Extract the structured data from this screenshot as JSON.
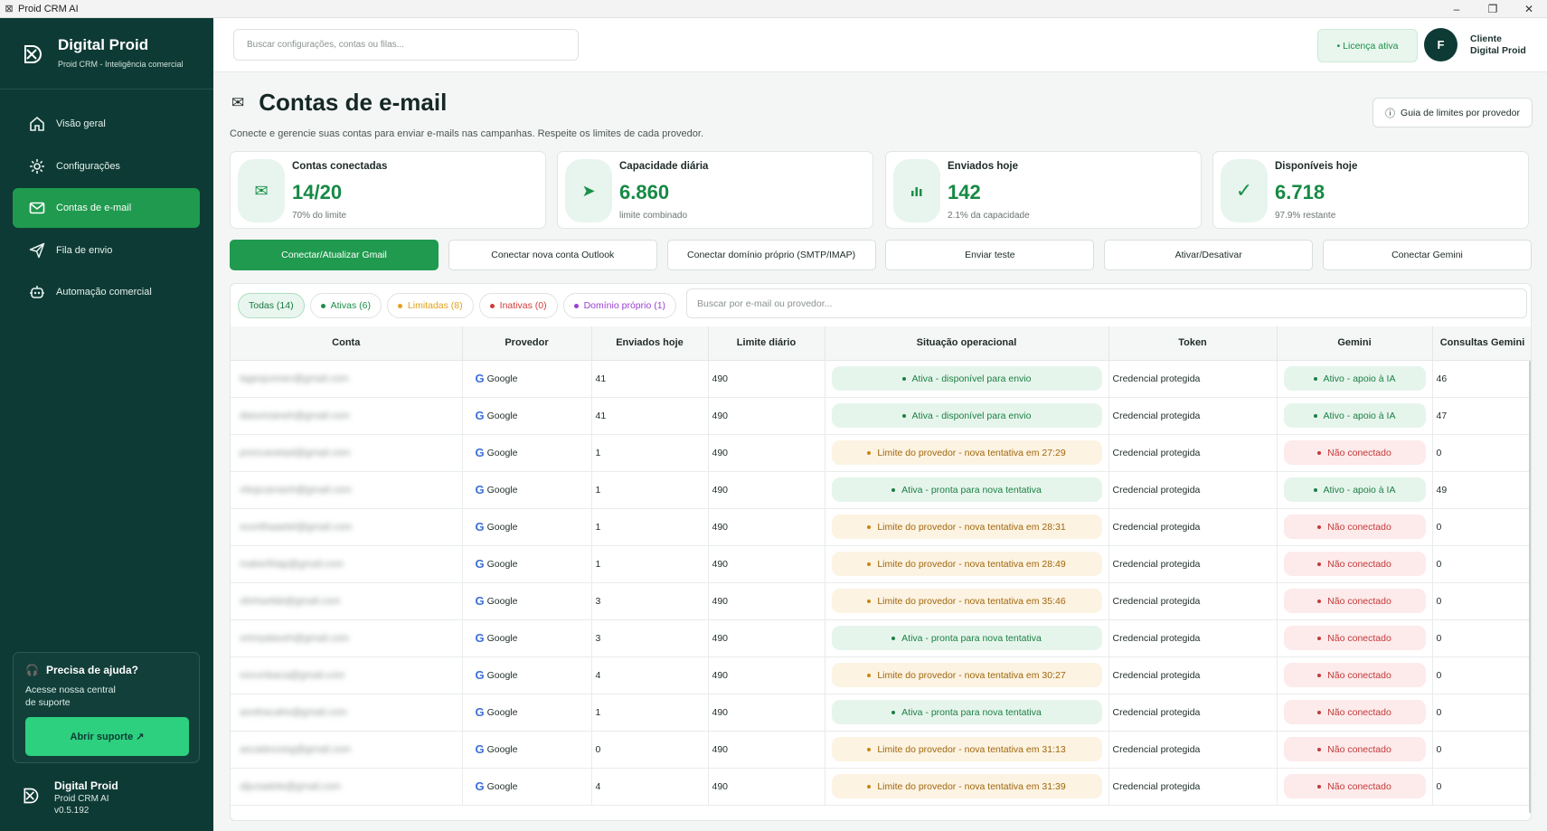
{
  "window": {
    "title": "Proid CRM AI",
    "controls": [
      "–",
      "❐",
      "✕"
    ]
  },
  "sidebar": {
    "brand_name": "Digital Proid",
    "brand_sub": "Proid CRM - Inteligência comercial",
    "items": [
      {
        "label": "Visão geral",
        "icon": "home-icon"
      },
      {
        "label": "Configurações",
        "icon": "gear-icon"
      },
      {
        "label": "Contas de e-mail",
        "icon": "mail-icon"
      },
      {
        "label": "Fila de envio",
        "icon": "send-icon"
      },
      {
        "label": "Automação comercial",
        "icon": "robot-icon"
      }
    ],
    "help": {
      "title": "Precisa de ajuda?",
      "desc": "Acesse nossa central de suporte",
      "button": "Abrir suporte ↗"
    },
    "footer": {
      "name": "Digital Proid",
      "app": "Proid CRM AI",
      "version": "v0.5.192"
    }
  },
  "topbar": {
    "search_placeholder": "Buscar configurações, contas ou filas...",
    "license": "• Licença ativa",
    "avatar": "F",
    "client_line1": "Cliente",
    "client_line2": "Digital Proid"
  },
  "page": {
    "title": "Contas de e-mail",
    "desc": "Conecte e gerencie suas contas para enviar e-mails nas campanhas. Respeite os limites de cada provedor.",
    "guide_button": "Guia de limites por provedor"
  },
  "stats": [
    {
      "label": "Contas conectadas",
      "value": "14/20",
      "sub": "70% do limite",
      "icon": "mail-icon",
      "glyph": "✉"
    },
    {
      "label": "Capacidade diária",
      "value": "6.860",
      "sub": "limite combinado",
      "icon": "send-icon",
      "glyph": "➤"
    },
    {
      "label": "Enviados hoje",
      "value": "142",
      "sub": "2.1% da capacidade",
      "icon": "bar-chart-icon",
      "glyph": "📊"
    },
    {
      "label": "Disponíveis hoje",
      "value": "6.718",
      "sub": "97.9% restante",
      "icon": "check-icon",
      "glyph": "✓"
    }
  ],
  "actions": [
    "Conectar/Atualizar Gmail",
    "Conectar nova conta Outlook",
    "Conectar domínio próprio (SMTP/IMAP)",
    "Enviar teste",
    "Ativar/Desativar",
    "Conectar Gemini"
  ],
  "filters": {
    "chips": [
      {
        "label": "Todas (14)",
        "color": ""
      },
      {
        "label": "Ativas (6)",
        "color": "#1b8f48"
      },
      {
        "label": "Limitadas (8)",
        "color": "#e2a21c"
      },
      {
        "label": "Inativas (0)",
        "color": "#d23b3b"
      },
      {
        "label": "Domínio próprio (1)",
        "color": "#9a3fd1"
      }
    ],
    "search_placeholder": "Buscar por e-mail ou provedor..."
  },
  "table": {
    "columns": [
      "Conta",
      "Provedor",
      "Enviados hoje",
      "Limite diário",
      "Situação operacional",
      "Token",
      "Gemini",
      "Consultas Gemini"
    ],
    "rows": [
      {
        "account": "lagesjunnior@gmail.com",
        "provider": "Google",
        "sent": "41",
        "limit": "490",
        "status": "Ativa - disponível para envio",
        "status_type": "ok",
        "token": "Credencial protegida",
        "gemini": "Ativo - apoio à IA",
        "gemini_type": "ok",
        "queries": "46"
      },
      {
        "account": "diasvivianeh@gmail.com",
        "provider": "Google",
        "sent": "41",
        "limit": "490",
        "status": "Ativa - disponível para envio",
        "status_type": "ok",
        "token": "Credencial protegida",
        "gemini": "Ativo - apoio à IA",
        "gemini_type": "ok",
        "queries": "47"
      },
      {
        "account": "proncanetad@gmail.com",
        "provider": "Google",
        "sent": "1",
        "limit": "490",
        "status": "Limite do provedor - nova tentativa em 27:29",
        "status_type": "warn",
        "token": "Credencial protegida",
        "gemini": "Não conectado",
        "gemini_type": "bad",
        "queries": "0"
      },
      {
        "account": "vitopcamanh@gmail.com",
        "provider": "Google",
        "sent": "1",
        "limit": "490",
        "status": "Ativa - pronta para nova tentativa",
        "status_type": "ok",
        "token": "Credencial protegida",
        "gemini": "Ativo - apoio à IA",
        "gemini_type": "ok",
        "queries": "49"
      },
      {
        "account": "ocorithaaetel@gmail.com",
        "provider": "Google",
        "sent": "1",
        "limit": "490",
        "status": "Limite do provedor - nova tentativa em 28:31",
        "status_type": "warn",
        "token": "Credencial protegida",
        "gemini": "Não conectado",
        "gemini_type": "bad",
        "queries": "0"
      },
      {
        "account": "makerlhlap@gmail.com",
        "provider": "Google",
        "sent": "1",
        "limit": "490",
        "status": "Limite do provedor - nova tentativa em 28:49",
        "status_type": "warn",
        "token": "Credencial protegida",
        "gemini": "Não conectado",
        "gemini_type": "bad",
        "queries": "0"
      },
      {
        "account": "olivhaofab@gmail.com",
        "provider": "Google",
        "sent": "3",
        "limit": "490",
        "status": "Limite do provedor - nova tentativa em 35:46",
        "status_type": "warn",
        "token": "Credencial protegida",
        "gemini": "Não conectado",
        "gemini_type": "bad",
        "queries": "0"
      },
      {
        "account": "ortmyalaveh@gmail.com",
        "provider": "Google",
        "sent": "3",
        "limit": "490",
        "status": "Ativa - pronta para nova tentativa",
        "status_type": "ok",
        "token": "Credencial protegida",
        "gemini": "Não conectado",
        "gemini_type": "bad",
        "queries": "0"
      },
      {
        "account": "oorumbaca@gmail.com",
        "provider": "Google",
        "sent": "4",
        "limit": "490",
        "status": "Limite do provedor - nova tentativa em 30:27",
        "status_type": "warn",
        "token": "Credencial protegida",
        "gemini": "Não conectado",
        "gemini_type": "bad",
        "queries": "0"
      },
      {
        "account": "aovthacafre@gmail.com",
        "provider": "Google",
        "sent": "1",
        "limit": "490",
        "status": "Ativa - pronta para nova tentativa",
        "status_type": "ok",
        "token": "Credencial protegida",
        "gemini": "Não conectado",
        "gemini_type": "bad",
        "queries": "0"
      },
      {
        "account": "ascadouviog@gmail.com",
        "provider": "Google",
        "sent": "0",
        "limit": "490",
        "status": "Limite do provedor - nova tentativa em 31:13",
        "status_type": "warn",
        "token": "Credencial protegida",
        "gemini": "Não conectado",
        "gemini_type": "bad",
        "queries": "0"
      },
      {
        "account": "aljuraatele@gmail.com",
        "provider": "Google",
        "sent": "4",
        "limit": "490",
        "status": "Limite do provedor - nova tentativa em 31:39",
        "status_type": "warn",
        "token": "Credencial protegida",
        "gemini": "Não conectado",
        "gemini_type": "bad",
        "queries": "0"
      }
    ]
  }
}
